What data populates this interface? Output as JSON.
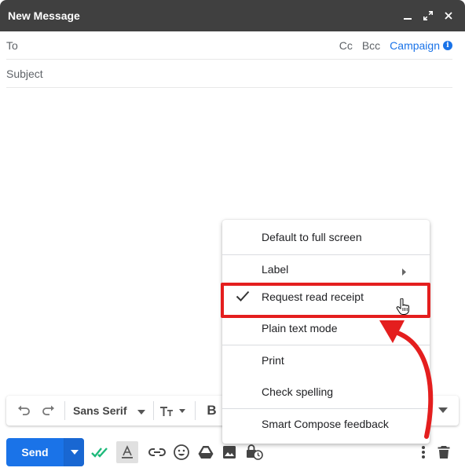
{
  "window": {
    "title": "New Message",
    "controls": [
      "minimize-icon",
      "expand-icon",
      "close-icon"
    ]
  },
  "recipients": {
    "to_label": "To",
    "cc": "Cc",
    "bcc": "Bcc",
    "campaign": "Campaign"
  },
  "subject": {
    "placeholder": "Subject"
  },
  "formatting": {
    "font": "Sans Serif",
    "icons": [
      "undo-icon",
      "redo-icon",
      "font-family-dropdown",
      "text-size-icon",
      "bold-icon",
      "italic-icon",
      "more-formatting-caret-icon"
    ]
  },
  "bottom": {
    "send": "Send",
    "icons": [
      "send-options-caret-icon",
      "tracking-checkmarks-icon",
      "formatting-options-icon",
      "link-icon",
      "emoji-icon",
      "drive-icon",
      "photo-icon",
      "confidential-mode-icon",
      "more-options-icon",
      "discard-icon"
    ]
  },
  "menu": {
    "items": [
      {
        "label": "Default to full screen"
      },
      {
        "label": "Label",
        "submenu": true
      },
      {
        "label": "Request read receipt",
        "checked": true,
        "highlighted": true
      },
      {
        "label": "Plain text mode"
      },
      {
        "label": "Print"
      },
      {
        "label": "Check spelling"
      },
      {
        "label": "Smart Compose feedback"
      }
    ]
  },
  "colors": {
    "title_bar": "#404040",
    "accent_blue": "#1a73e8",
    "annotation_red": "#e41e1e",
    "tracking_green": "#1db97a"
  }
}
